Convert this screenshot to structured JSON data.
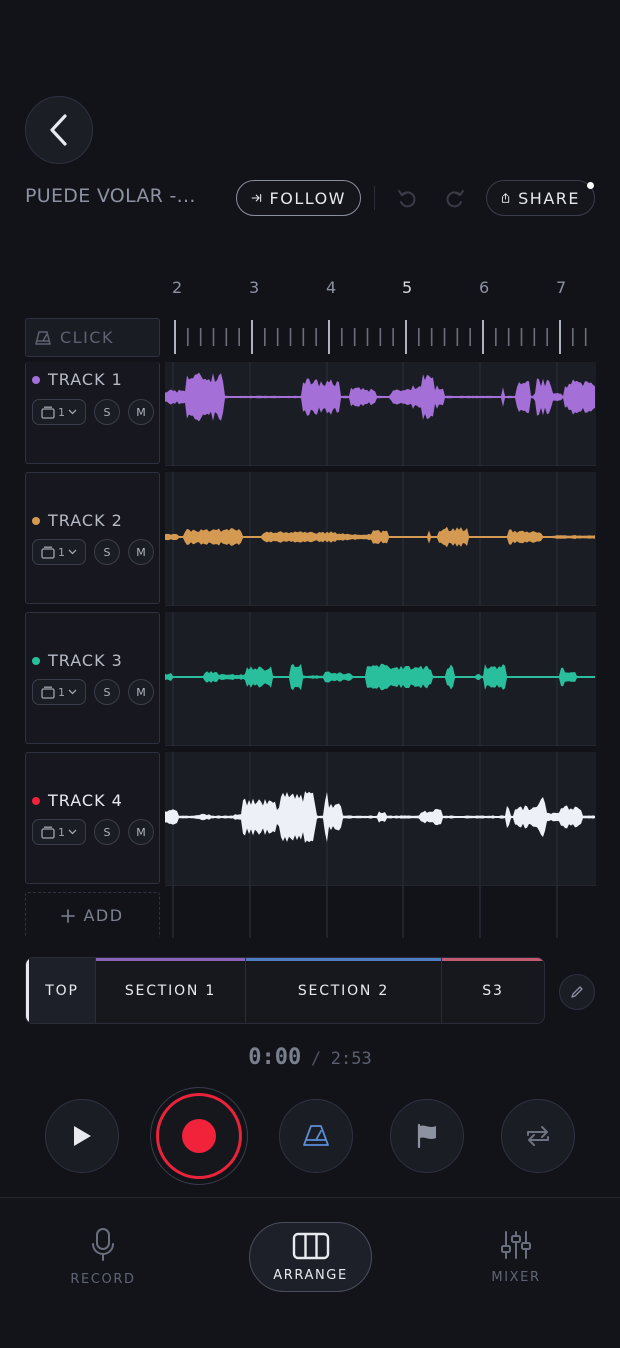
{
  "header": {
    "song_title": "PUEDE VOLAR -...",
    "follow_label": "FOLLOW",
    "share_label": "SHARE"
  },
  "ruler": {
    "bar_numbers": [
      "2",
      "3",
      "4",
      "5",
      "6",
      "7"
    ],
    "click_label": "CLICK"
  },
  "tracks": [
    {
      "name": "TRACK 1",
      "color": "#a46fd6",
      "input": "1",
      "solo": "S",
      "mute": "M"
    },
    {
      "name": "TRACK 2",
      "color": "#d49a52",
      "input": "1",
      "solo": "S",
      "mute": "M"
    },
    {
      "name": "TRACK 3",
      "color": "#29bf9c",
      "input": "1",
      "solo": "S",
      "mute": "M"
    },
    {
      "name": "TRACK 4",
      "color": "#f0233b",
      "input": "1",
      "solo": "S",
      "mute": "M"
    }
  ],
  "waveform_colors": [
    "#a46fd6",
    "#d49a52",
    "#29bf9c",
    "#eef0f8"
  ],
  "add_label": "ADD",
  "sections": [
    {
      "label": "TOP",
      "color": ""
    },
    {
      "label": "SECTION 1",
      "color": "#8a62b8"
    },
    {
      "label": "SECTION 2",
      "color": "#4d7fc0"
    },
    {
      "label": "S3",
      "color": "#c25a72"
    }
  ],
  "time": {
    "current": "0:00",
    "separator": "/",
    "total": "2:53"
  },
  "transport": {
    "play_icon": "play-icon",
    "record_icon": "record-icon",
    "metronome_icon": "metronome-icon",
    "marker_icon": "flag-icon",
    "loop_icon": "loop-icon"
  },
  "nav": {
    "record_label": "RECORD",
    "arrange_label": "ARRANGE",
    "mixer_label": "MIXER"
  }
}
